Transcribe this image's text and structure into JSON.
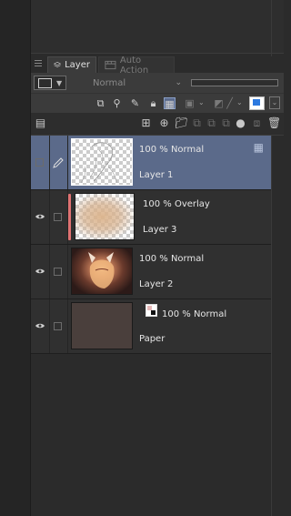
{
  "tabs": [
    {
      "label": "Layer",
      "icon": "layers-icon",
      "active": true
    },
    {
      "label": "Auto Action",
      "icon": "film-icon",
      "active": false
    }
  ],
  "toolbar": {
    "blend_mode": "Normal"
  },
  "layers": [
    {
      "opacity_mode": "100 % Normal",
      "name": "Layer 1",
      "selected": true,
      "visible": false
    },
    {
      "opacity_mode": "100 % Overlay",
      "name": "Layer 3",
      "selected": false,
      "visible": true
    },
    {
      "opacity_mode": "100 % Normal",
      "name": "Layer 2",
      "selected": false,
      "visible": true
    },
    {
      "opacity_mode": "100 % Normal",
      "name": "Paper",
      "selected": false,
      "visible": true
    }
  ],
  "colors": {
    "selected_row": "#5b6a8a",
    "clip_marker": "#e07272",
    "paper_color": "#4a3f3c"
  }
}
